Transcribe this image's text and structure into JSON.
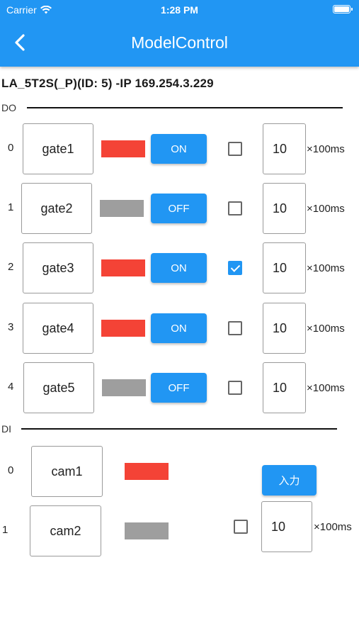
{
  "status_bar": {
    "carrier": "Carrier",
    "time": "1:28 PM"
  },
  "app_bar": {
    "title": "ModelControl",
    "back_icon": "chevron-left-icon"
  },
  "device_line": "LA_5T2S(_P)(ID: 5) -IP 169.254.3.229",
  "colors": {
    "primary": "#2196f3",
    "indicator_on": "#f44336",
    "indicator_off": "#9e9e9e"
  },
  "do_section": {
    "label": "DO",
    "rows": [
      {
        "index": "0",
        "name": "gate1",
        "indicator": "on",
        "button": "ON",
        "checked": false,
        "value": "10",
        "unit": "×100ms"
      },
      {
        "index": "1",
        "name": "gate2",
        "indicator": "off",
        "button": "OFF",
        "checked": false,
        "value": "10",
        "unit": "×100ms"
      },
      {
        "index": "2",
        "name": "gate3",
        "indicator": "on",
        "button": "ON",
        "checked": true,
        "value": "10",
        "unit": "×100ms"
      },
      {
        "index": "3",
        "name": "gate4",
        "indicator": "on",
        "button": "ON",
        "checked": false,
        "value": "10",
        "unit": "×100ms"
      },
      {
        "index": "4",
        "name": "gate5",
        "indicator": "off",
        "button": "OFF",
        "checked": false,
        "value": "10",
        "unit": "×100ms"
      }
    ]
  },
  "di_section": {
    "label": "DI",
    "rows": [
      {
        "index": "0",
        "name": "cam1",
        "indicator": "on"
      },
      {
        "index": "1",
        "name": "cam2",
        "indicator": "off"
      }
    ],
    "input_button": "入力",
    "checked": false,
    "value": "10",
    "unit": "×100ms"
  }
}
